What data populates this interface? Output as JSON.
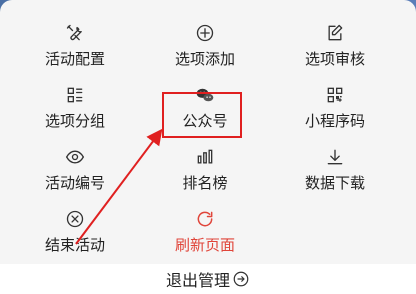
{
  "menu": {
    "items": [
      {
        "label": "活动配置",
        "icon": "tools-icon"
      },
      {
        "label": "选项添加",
        "icon": "plus-circle-icon"
      },
      {
        "label": "选项审核",
        "icon": "edit-icon"
      },
      {
        "label": "选项分组",
        "icon": "list-icon"
      },
      {
        "label": "公众号",
        "icon": "wechat-icon"
      },
      {
        "label": "小程序码",
        "icon": "qrcode-icon"
      },
      {
        "label": "活动编号",
        "icon": "eye-icon"
      },
      {
        "label": "排名榜",
        "icon": "bar-chart-icon"
      },
      {
        "label": "数据下载",
        "icon": "download-icon"
      },
      {
        "label": "结束活动",
        "icon": "close-circle-icon"
      },
      {
        "label": "刷新页面",
        "icon": "refresh-icon",
        "color": "#e0453a"
      }
    ]
  },
  "footer": {
    "logout_label": "退出管理"
  },
  "annotation": {
    "highlight_color": "#e02020"
  }
}
